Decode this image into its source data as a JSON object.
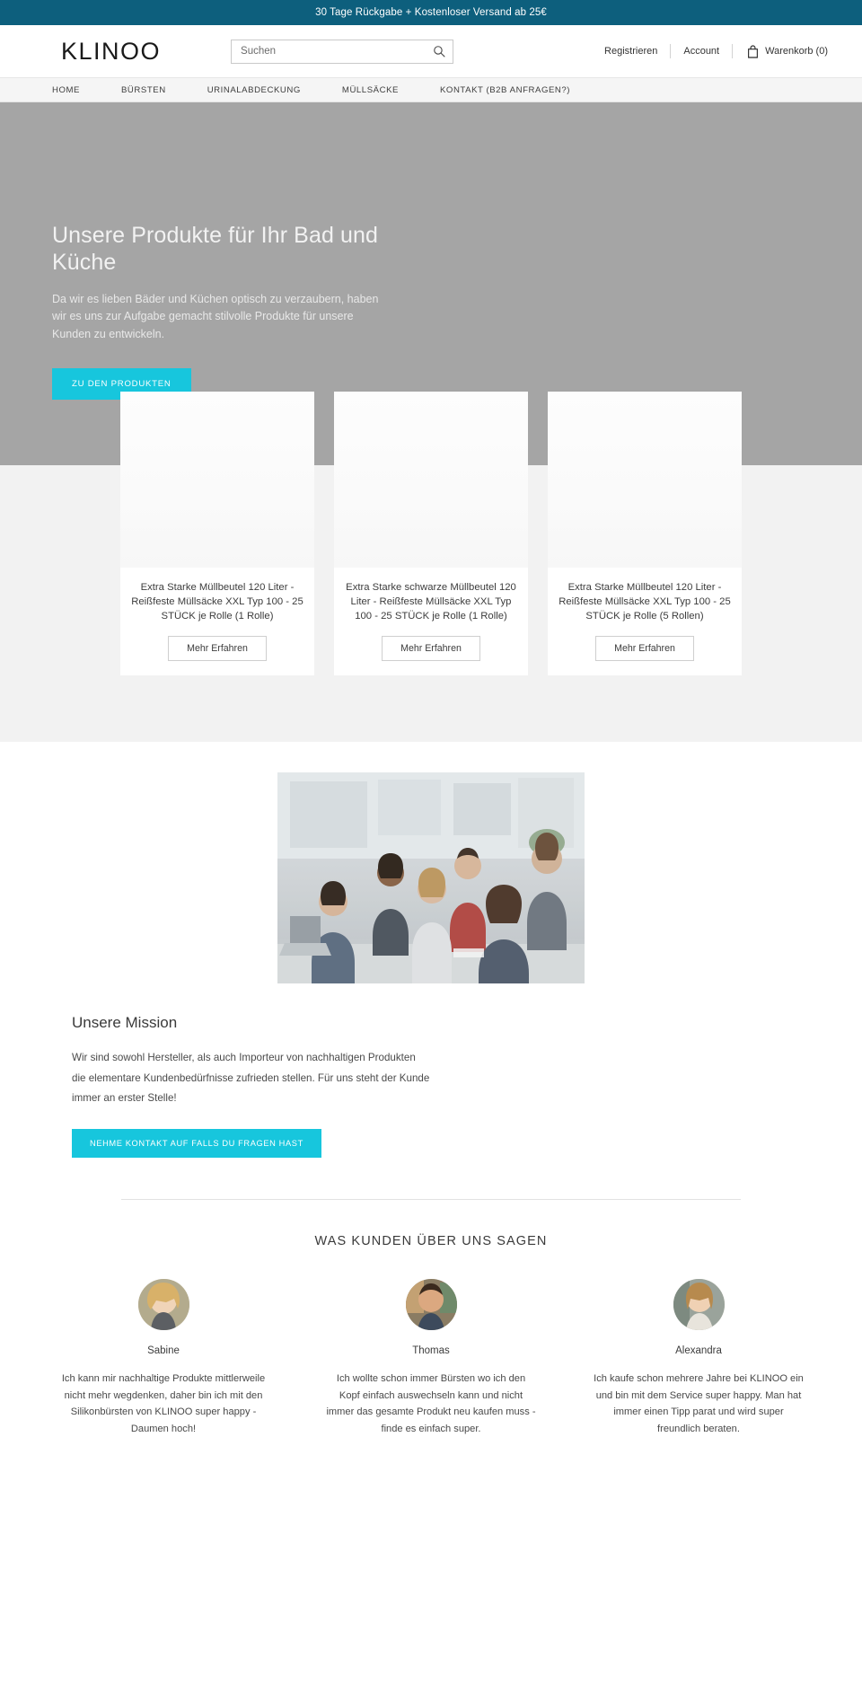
{
  "announcement": {
    "text": "30 Tage Rückgabe + Kostenloser Versand ab 25€"
  },
  "brand": {
    "name": "KLINOO"
  },
  "search": {
    "placeholder": "Suchen",
    "value": "",
    "icon": "search-icon"
  },
  "header": {
    "register_label": "Registrieren",
    "account_label": "Account",
    "cart_label": "Warenkorb (0)",
    "cart_icon": "shopping-bag-icon"
  },
  "nav": {
    "items": [
      {
        "label": "HOME"
      },
      {
        "label": "BÜRSTEN"
      },
      {
        "label": "URINALABDECKUNG"
      },
      {
        "label": "MÜLLSÄCKE"
      },
      {
        "label": "KONTAKT (B2B ANFRAGEN?)"
      }
    ]
  },
  "hero": {
    "title": "Unsere Produkte für Ihr Bad und Küche",
    "paragraph": "Da wir es lieben Bäder und Küchen optisch zu verzaubern, haben wir es uns zur Aufgabe gemacht stilvolle Produkte für unsere Kunden zu entwickeln.",
    "cta_label": "ZU DEN PRODUKTEN"
  },
  "products": {
    "more_label": "Mehr Erfahren",
    "items": [
      {
        "title": "Extra Starke Müllbeutel 120 Liter - Reißfeste Müllsäcke XXL Typ 100 - 25 STÜCK je Rolle (1 Rolle)"
      },
      {
        "title": "Extra Starke schwarze Müllbeutel 120 Liter - Reißfeste Müllsäcke XXL Typ 100 - 25 STÜCK je Rolle (1 Rolle)"
      },
      {
        "title": "Extra Starke Müllbeutel 120 Liter - Reißfeste Müllsäcke XXL Typ 100 - 25 STÜCK je Rolle (5 Rollen)"
      }
    ]
  },
  "mission": {
    "heading": "Unsere Mission",
    "paragraph": "Wir sind sowohl Hersteller, als auch Importeur von nachhaltigen Produkten die elementare Kundenbedürfnisse zufrieden stellen. Für uns steht der Kunde immer an erster Stelle!",
    "cta_label": "NEHME KONTAKT AUF FALLS DU FRAGEN HAST",
    "image_alt": "team-meeting-photo"
  },
  "testimonials": {
    "heading": "WAS KUNDEN ÜBER UNS SAGEN",
    "items": [
      {
        "name": "Sabine",
        "text": "Ich kann mir nachhaltige Produkte mittlerweile nicht mehr wegdenken, daher bin ich mit den Silikonbürsten von KLINOO super happy - Daumen hoch!"
      },
      {
        "name": "Thomas",
        "text": "Ich wollte schon immer Bürsten wo ich den Kopf einfach auswechseln kann und nicht immer das gesamte Produkt neu kaufen muss - finde es einfach super."
      },
      {
        "name": "Alexandra",
        "text": "Ich kaufe schon mehrere Jahre bei KLINOO ein und bin mit dem Service super happy. Man hat immer einen Tipp parat und wird super freundlich beraten."
      }
    ]
  },
  "colors": {
    "announcement_bg": "#0d5f7d",
    "accent": "#17c6dd",
    "hero_bg": "#a5a5a5",
    "band_bg": "#f2f2f2",
    "nav_bg": "#f5f5f5"
  }
}
